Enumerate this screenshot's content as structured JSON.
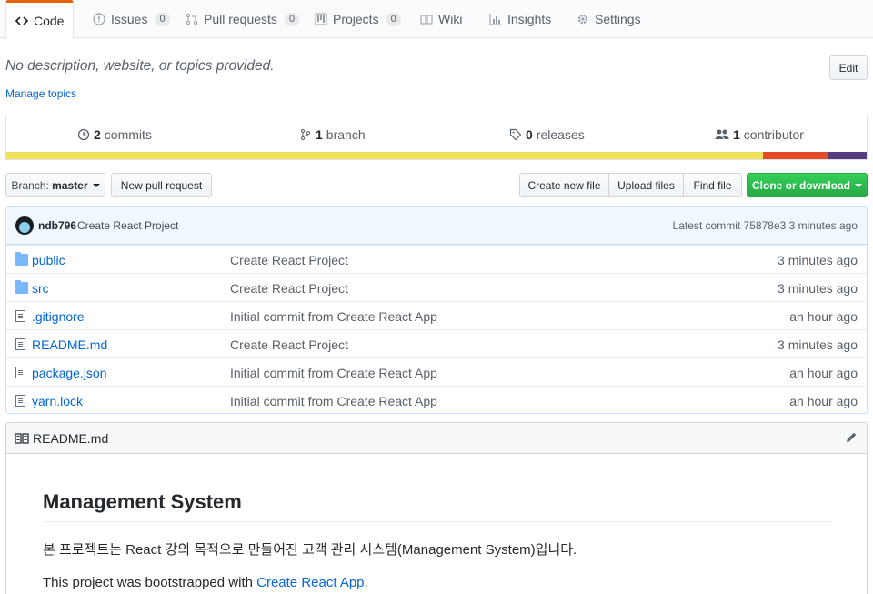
{
  "tabs": [
    {
      "label": "Code",
      "icon": "code-icon",
      "selected": true
    },
    {
      "label": "Issues",
      "icon": "issue-icon",
      "count": "0"
    },
    {
      "label": "Pull requests",
      "icon": "pull-request-icon",
      "count": "0"
    },
    {
      "label": "Projects",
      "icon": "project-icon",
      "count": "0"
    },
    {
      "label": "Wiki",
      "icon": "book-icon"
    },
    {
      "label": "Insights",
      "icon": "graph-icon"
    },
    {
      "label": "Settings",
      "icon": "gear-icon"
    }
  ],
  "repo": {
    "description": "No description, website, or topics provided.",
    "edit_label": "Edit",
    "manage_topics": "Manage topics"
  },
  "summary": {
    "commits_count": "2",
    "commits_label": "commits",
    "branch_count": "1",
    "branch_label": "branch",
    "releases_count": "0",
    "releases_label": "releases",
    "contributor_count": "1",
    "contributor_label": "contributor",
    "language_bar": [
      {
        "color": "#f1e05a",
        "share": 0.88
      },
      {
        "color": "#e34c26",
        "share": 0.075
      },
      {
        "color": "#563d7c",
        "share": 0.045
      }
    ]
  },
  "toolbar": {
    "branch_prefix": "Branch:",
    "branch_name": "master",
    "new_pr": "New pull request",
    "create_file": "Create new file",
    "upload_files": "Upload files",
    "find_file": "Find file",
    "clone": "Clone or download"
  },
  "latest_commit": {
    "author": "ndb796",
    "message": "Create React Project",
    "info": "Latest commit 75878e3 3 minutes ago"
  },
  "files": [
    {
      "name": "public",
      "type": "folder",
      "message": "Create React Project",
      "age": "3 minutes ago"
    },
    {
      "name": "src",
      "type": "folder",
      "message": "Create React Project",
      "age": "3 minutes ago"
    },
    {
      "name": ".gitignore",
      "type": "file",
      "message": "Initial commit from Create React App",
      "age": "an hour ago"
    },
    {
      "name": "README.md",
      "type": "file",
      "message": "Create React Project",
      "age": "3 minutes ago"
    },
    {
      "name": "package.json",
      "type": "file",
      "message": "Initial commit from Create React App",
      "age": "an hour ago"
    },
    {
      "name": "yarn.lock",
      "type": "file",
      "message": "Initial commit from Create React App",
      "age": "an hour ago"
    }
  ],
  "readme": {
    "filename": "README.md",
    "heading": "Management System",
    "paragraph1": "본 프로젝트는 React 강의 목적으로 만들어진 고객 관리 시스템(Management System)입니다.",
    "paragraph2_prefix": "This project was bootstrapped with ",
    "paragraph2_link": "Create React App",
    "paragraph2_suffix": "."
  }
}
